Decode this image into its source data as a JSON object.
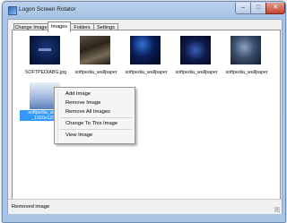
{
  "window": {
    "title": "Logon Screen Rotator",
    "minimize_glyph": "–",
    "maximize_glyph": "□",
    "close_glyph": "✕"
  },
  "tabs": [
    {
      "label": "Change Image"
    },
    {
      "label": "Images"
    },
    {
      "label": "Folders"
    },
    {
      "label": "Settings"
    }
  ],
  "active_tab": "Images",
  "images": [
    {
      "label": "SOFTPEDIABG.jpg",
      "icon": "image-thumbnail-icon"
    },
    {
      "label": "softpedia_wallpaper",
      "icon": "image-thumbnail-icon"
    },
    {
      "label": "softpedia_wallpaper",
      "icon": "image-thumbnail-icon"
    },
    {
      "label": "softpedia_wallpaper",
      "icon": "image-thumbnail-icon"
    },
    {
      "label": "softpedia_wallpaper",
      "icon": "image-thumbnail-icon"
    },
    {
      "label_line1": "softpedia_wallpa",
      "label_line2": "_1920x1200_",
      "icon": "image-thumbnail-icon",
      "selected": true
    }
  ],
  "context_menu": {
    "items": [
      "Add Image",
      "Remove Image",
      "Remove All Images",
      "Change To This Image",
      "View Image"
    ]
  },
  "status": {
    "text": "Removed image"
  },
  "colors": {
    "selection": "#3399ff",
    "title_bar": "#a8c3e3",
    "close_button": "#c5422c"
  }
}
